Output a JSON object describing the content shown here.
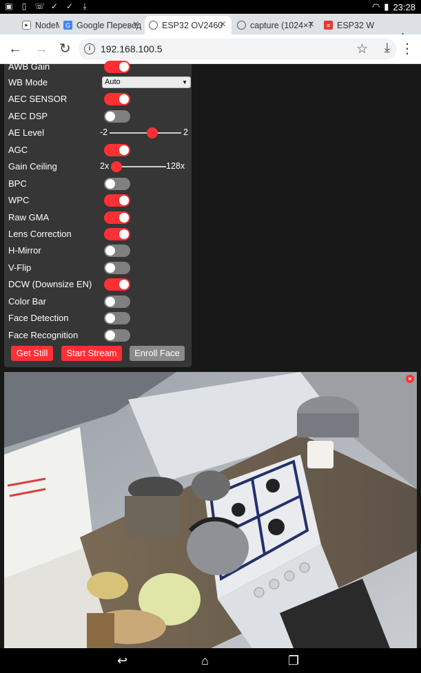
{
  "status_bar": {
    "time": "23:28",
    "icons": [
      "photo-icon",
      "sim-icon",
      "missed-call-icon",
      "check-icon",
      "check-icon",
      "download-done-icon"
    ]
  },
  "tabs": [
    {
      "label": "NodeMCU",
      "favicon": "youtube-icon",
      "active": false
    },
    {
      "label": "Google Перевод",
      "favicon": "translate-icon",
      "active": false
    },
    {
      "label": "ESP32 OV2460",
      "favicon": "globe-icon",
      "active": true
    },
    {
      "label": "capture (1024×7",
      "favicon": "globe-icon",
      "active": false
    },
    {
      "label": "ESP32 W",
      "favicon": "red-logo-icon",
      "active": false
    }
  ],
  "toolbar": {
    "url": "192.168.100.5"
  },
  "settings": {
    "rows": [
      {
        "label": "AWB Gain",
        "type": "switch",
        "on": true
      },
      {
        "label": "WB Mode",
        "type": "select",
        "value": "Auto"
      },
      {
        "label": "AEC SENSOR",
        "type": "switch",
        "on": true
      },
      {
        "label": "AEC DSP",
        "type": "switch",
        "on": false
      },
      {
        "label": "AE Level",
        "type": "range",
        "min": "-2",
        "max": "2",
        "value": 0.6
      },
      {
        "label": "AGC",
        "type": "switch",
        "on": true
      },
      {
        "label": "Gain Ceiling",
        "type": "range",
        "min": "2x",
        "max": "128x",
        "value": 0.0
      },
      {
        "label": "BPC",
        "type": "switch",
        "on": false
      },
      {
        "label": "WPC",
        "type": "switch",
        "on": true
      },
      {
        "label": "Raw GMA",
        "type": "switch",
        "on": true
      },
      {
        "label": "Lens Correction",
        "type": "switch",
        "on": true
      },
      {
        "label": "H-Mirror",
        "type": "switch",
        "on": false
      },
      {
        "label": "V-Flip",
        "type": "switch",
        "on": false
      },
      {
        "label": "DCW (Downsize EN)",
        "type": "switch",
        "on": true
      },
      {
        "label": "Color Bar",
        "type": "switch",
        "on": false
      },
      {
        "label": "Face Detection",
        "type": "switch",
        "on": false
      },
      {
        "label": "Face Recognition",
        "type": "switch",
        "on": false
      }
    ],
    "buttons": {
      "get_still": "Get Still",
      "start_stream": "Start Stream",
      "enroll_face": "Enroll Face"
    }
  },
  "colors": {
    "accent": "#ff3034",
    "panel_bg": "#363636",
    "switch_off": "#808080"
  }
}
